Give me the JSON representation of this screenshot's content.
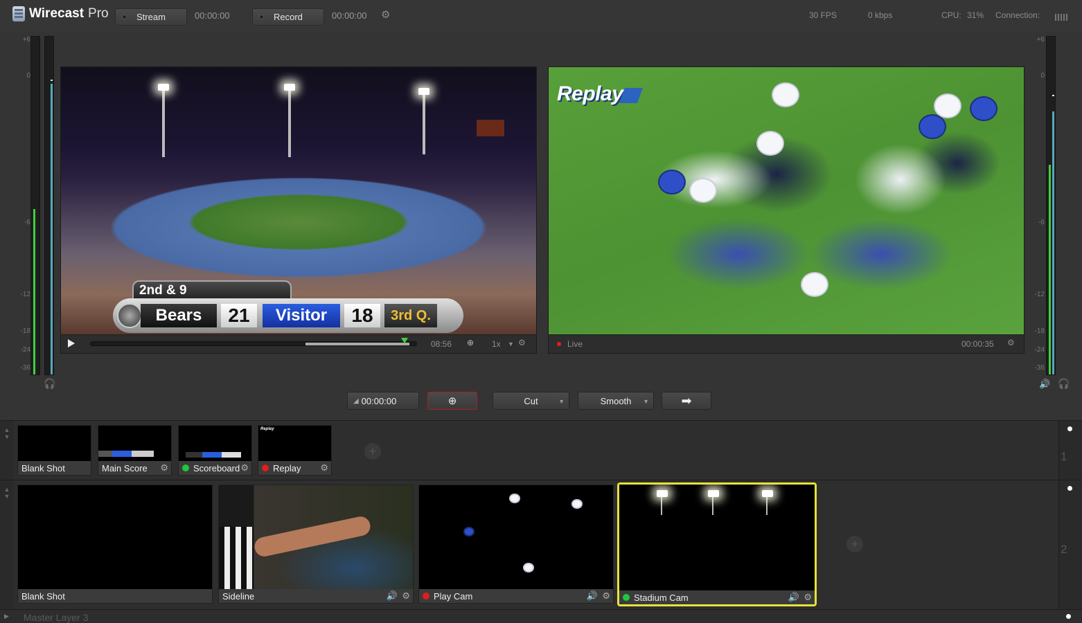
{
  "app": {
    "name": "Wirecast",
    "edition": "Pro"
  },
  "toolbar": {
    "stream_label": "Stream",
    "stream_time": "00:00:00",
    "record_label": "Record",
    "record_time": "00:00:00",
    "fps": "30 FPS",
    "bitrate": "0 kbps",
    "cpu_label": "CPU:",
    "cpu_value": "31%",
    "connection_label": "Connection:"
  },
  "vu": {
    "scale_ticks": [
      "+6",
      "0",
      "-6",
      "-12",
      "-18",
      "-24",
      "-36"
    ],
    "left_level": 0.49,
    "right_level": 0.62
  },
  "preview": {
    "scoreboard": {
      "down": "2nd & 9",
      "home_team": "Bears",
      "home_score": "21",
      "away_team": "Visitor",
      "away_score": "18",
      "quarter": "3rd Q."
    },
    "duration": "08:56",
    "speed": "1x"
  },
  "live": {
    "overlay_title": "Replay",
    "status": "Live",
    "time": "00:00:35"
  },
  "transition": {
    "timecode": "00:00:00",
    "cut_label": "Cut",
    "smooth_label": "Smooth"
  },
  "layers": [
    {
      "number": "1",
      "shots": [
        {
          "label": "Blank Shot",
          "status": "",
          "status_color": ""
        },
        {
          "label": "Main Score",
          "status": "",
          "status_color": ""
        },
        {
          "label": "Scoreboard",
          "status": "active",
          "status_color": "#1fc83a"
        },
        {
          "label": "Replay",
          "status": "live",
          "status_color": "#e01e1e"
        }
      ]
    },
    {
      "number": "2",
      "shots": [
        {
          "label": "Blank Shot",
          "status": "",
          "status_color": ""
        },
        {
          "label": "Sideline",
          "status": "",
          "status_color": ""
        },
        {
          "label": "Play Cam",
          "status": "live",
          "status_color": "#e01e1e"
        },
        {
          "label": "Stadium Cam",
          "status": "preview",
          "status_color": "#1fc83a"
        }
      ]
    }
  ],
  "master_layer": {
    "label": "Master Layer 3"
  },
  "colors": {
    "live": "#e01e1e",
    "preview": "#1fc83a",
    "selection": "#e8e23a",
    "meter": "#3fd13f"
  }
}
